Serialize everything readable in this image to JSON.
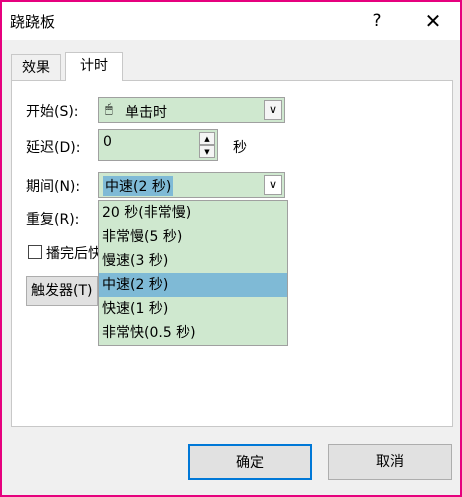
{
  "window": {
    "title": "跷跷板",
    "help": "?",
    "close": "✕"
  },
  "tabs": [
    {
      "label": "效果"
    },
    {
      "label": "计时"
    }
  ],
  "form": {
    "start": {
      "label": "开始(S):",
      "value": "单击时"
    },
    "delay": {
      "label": "延迟(D):",
      "value": "0",
      "unit": "秒"
    },
    "duration": {
      "label": "期间(N):",
      "value": "中速(2 秒)"
    },
    "repeat": {
      "label": "重复(R):"
    },
    "rewind": {
      "label": "播完后快"
    },
    "trigger": {
      "label": "触发器(T)"
    }
  },
  "dropdown": {
    "options": [
      "20 秒(非常慢)",
      "非常慢(5 秒)",
      "慢速(3 秒)",
      "中速(2 秒)",
      "快速(1 秒)",
      "非常快(0.5 秒)"
    ],
    "selected": "中速(2 秒)"
  },
  "buttons": {
    "ok": "确定",
    "cancel": "取消"
  }
}
